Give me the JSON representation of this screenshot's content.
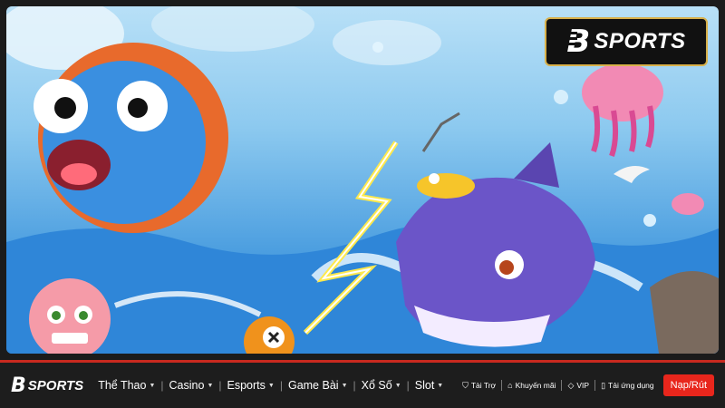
{
  "brand": {
    "logo_letter": "B",
    "logo_word": "SPORTS"
  },
  "colors": {
    "accent_red": "#e8261c",
    "nav_bg": "#1d1d1d",
    "badge_border": "#d8b04a"
  },
  "nav": {
    "items": [
      {
        "label": "Thể Thao",
        "has_caret": true
      },
      {
        "label": "Casino",
        "has_caret": true
      },
      {
        "label": "Esports",
        "has_caret": true
      },
      {
        "label": "Game Bài",
        "has_caret": true
      },
      {
        "label": "Xổ Số",
        "has_caret": true
      },
      {
        "label": "Slot",
        "has_caret": true
      }
    ],
    "separator": "|",
    "utilities": [
      {
        "icon": "shield-icon",
        "label": "Tài Trợ"
      },
      {
        "icon": "tag-icon",
        "label": "Khuyến mãi"
      },
      {
        "icon": "diamond-icon",
        "label": "VIP"
      },
      {
        "icon": "phone-icon",
        "label": "Tải ứng dụng"
      }
    ],
    "cta_label": "Nạp/Rút"
  }
}
